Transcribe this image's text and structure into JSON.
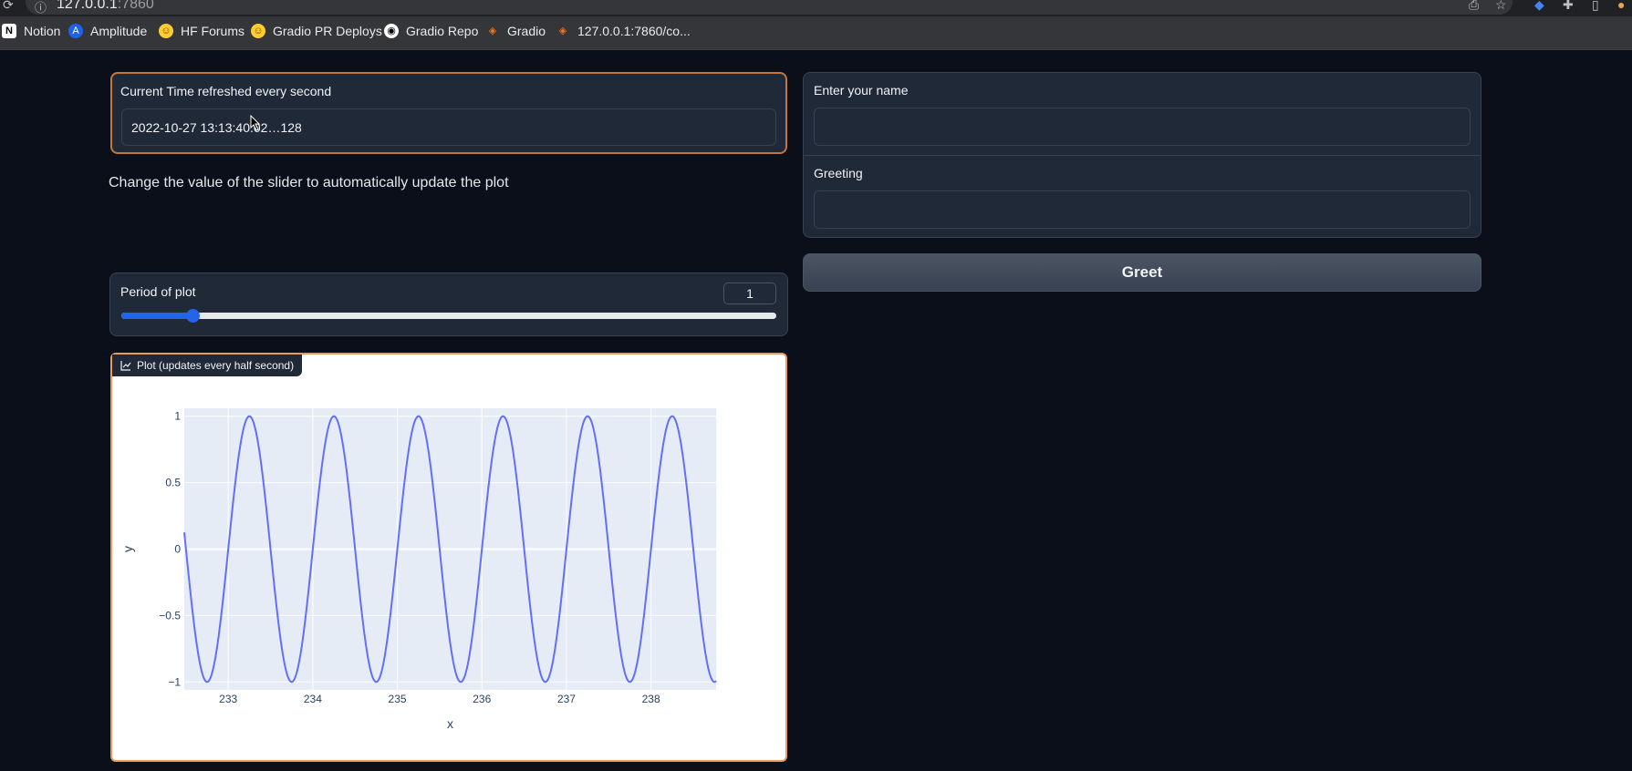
{
  "browser": {
    "url_host": "127.0.0.1",
    "url_port": ":7860",
    "bookmarks": [
      {
        "label": "Notion",
        "icon": "notion-icon"
      },
      {
        "label": "Amplitude",
        "icon": "amplitude-icon"
      },
      {
        "label": "HF Forums",
        "icon": "huggingface-icon"
      },
      {
        "label": "Gradio PR Deploys",
        "icon": "huggingface-icon"
      },
      {
        "label": "Gradio Repo",
        "icon": "github-icon"
      },
      {
        "label": "Gradio",
        "icon": "gradio-icon"
      },
      {
        "label": "127.0.0.1:7860/co...",
        "icon": "gradio-icon"
      }
    ]
  },
  "left": {
    "time_label": "Current Time refreshed every second",
    "time_value": "2022-10-27 13:13:40.02…128",
    "description": "Change the value of the slider to automatically update the plot",
    "slider_label": "Period of plot",
    "slider_value": "1",
    "slider_fraction": 0.108,
    "plot_label": "Plot (updates every half second)"
  },
  "right": {
    "name_label": "Enter your name",
    "name_value": "",
    "greeting_label": "Greeting",
    "greeting_value": "",
    "greet_button": "Greet"
  },
  "colors": {
    "accent": "#2563eb",
    "focus_border": "#c2773a",
    "line": "#636efa",
    "plot_bg": "#e5ecf6"
  },
  "chart_data": {
    "type": "line",
    "title": "",
    "xlabel": "x",
    "ylabel": "y",
    "xlim": [
      232.48,
      238.77
    ],
    "ylim": [
      -1.06,
      1.06
    ],
    "xticks": [
      233,
      234,
      235,
      236,
      237,
      238
    ],
    "xtick_labels": [
      "233",
      "234",
      "235",
      "236",
      "237",
      "238"
    ],
    "yticks": [
      1,
      0.5,
      0,
      -0.5,
      -1
    ],
    "ytick_labels": [
      "1",
      "0.5",
      "0",
      "−0.5",
      "−1"
    ],
    "series": [
      {
        "function": "sin(2*pi*x/period)",
        "period": 1,
        "x_start": 232.48,
        "x_end": 238.77
      }
    ],
    "grid": true
  }
}
